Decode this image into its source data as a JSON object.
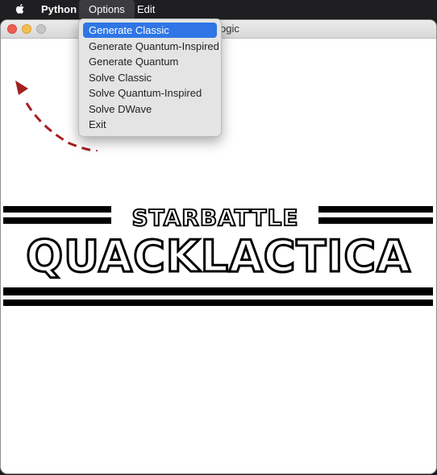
{
  "menubar": {
    "apple_icon": "apple-logo-icon",
    "items": [
      "Python",
      "Options",
      "Edit"
    ]
  },
  "window": {
    "title_fragment": "ogic"
  },
  "options_menu": {
    "items": [
      "Generate Classic",
      "Generate Quantum-Inspired",
      "Generate Quantum",
      "Solve Classic",
      "Solve Quantum-Inspired",
      "Solve DWave",
      "Exit"
    ],
    "selected_index": 0
  },
  "logo": {
    "line1": "STARBATTLE",
    "line2": "QUACKLACTICA"
  },
  "colors": {
    "menubar_bg": "#1f1f22",
    "selection": "#2f75e6",
    "close": "#ee5c52",
    "minimize": "#f4bd4f",
    "annotation_arrow": "#a32020"
  }
}
